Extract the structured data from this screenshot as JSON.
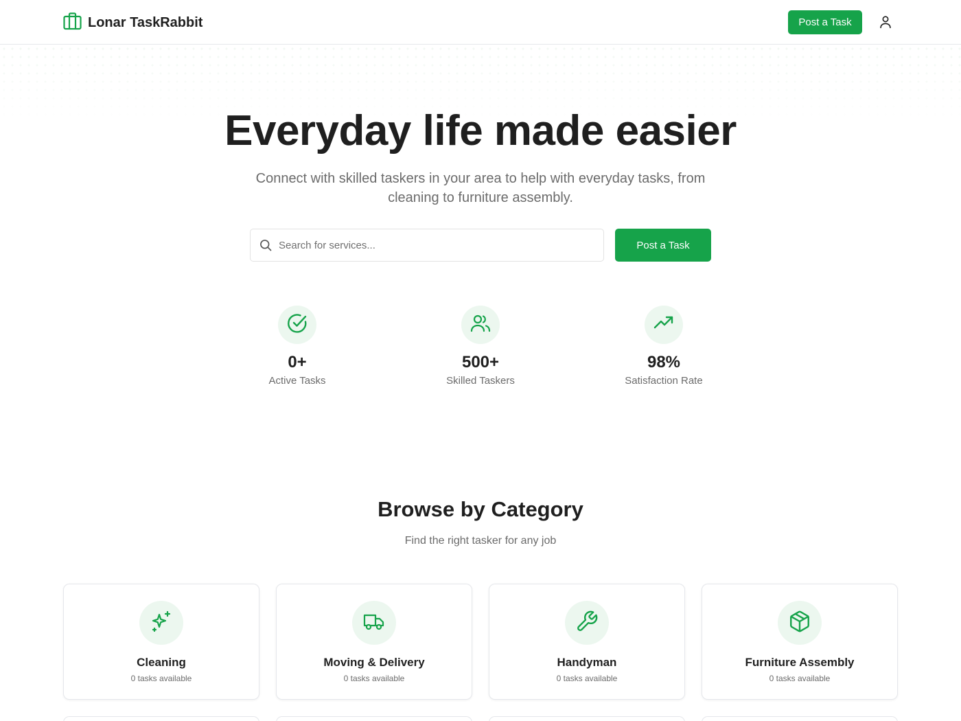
{
  "header": {
    "brand": "Lonar TaskRabbit",
    "post_task_label": "Post a Task"
  },
  "hero": {
    "title": "Everyday life made easier",
    "subtitle": "Connect with skilled taskers in your area to help with everyday tasks, from cleaning to furniture assembly.",
    "search_placeholder": "Search for services...",
    "post_task_label": "Post a Task"
  },
  "stats": [
    {
      "icon": "check-circle-icon",
      "value": "0+",
      "label": "Active Tasks"
    },
    {
      "icon": "users-icon",
      "value": "500+",
      "label": "Skilled Taskers"
    },
    {
      "icon": "trending-up-icon",
      "value": "98%",
      "label": "Satisfaction Rate"
    }
  ],
  "categories": {
    "title": "Browse by Category",
    "subtitle": "Find the right tasker for any job",
    "items": [
      {
        "icon": "sparkles-icon",
        "name": "Cleaning",
        "count": "0 tasks available"
      },
      {
        "icon": "truck-icon",
        "name": "Moving & Delivery",
        "count": "0 tasks available"
      },
      {
        "icon": "wrench-icon",
        "name": "Handyman",
        "count": "0 tasks available"
      },
      {
        "icon": "box-icon",
        "name": "Furniture Assembly",
        "count": "0 tasks available"
      }
    ]
  },
  "colors": {
    "accent": "#16a34a",
    "icon_bg": "#ecf7ef",
    "text": "#1f1f1f",
    "muted": "#6b6b6b"
  }
}
